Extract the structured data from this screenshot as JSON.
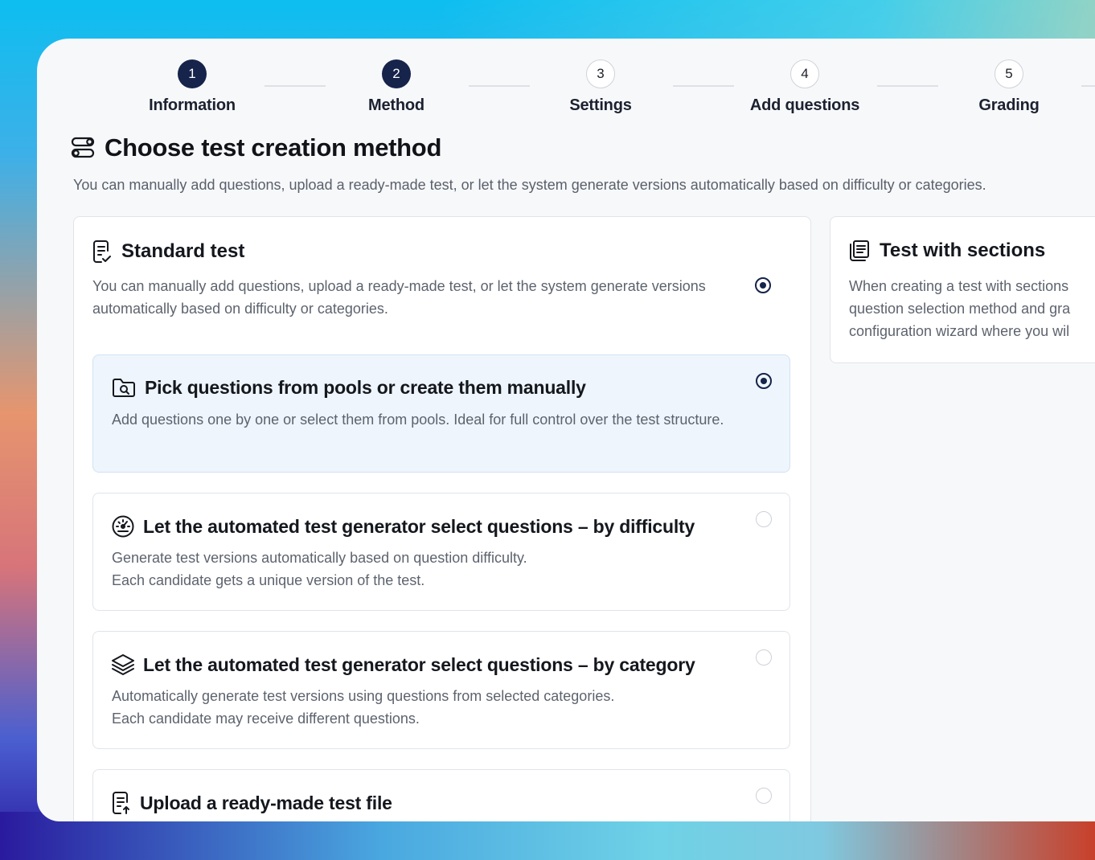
{
  "stepper": [
    {
      "num": "1",
      "label": "Information",
      "state": "done"
    },
    {
      "num": "2",
      "label": "Method",
      "state": "done"
    },
    {
      "num": "3",
      "label": "Settings",
      "state": "todo"
    },
    {
      "num": "4",
      "label": "Add questions",
      "state": "todo"
    },
    {
      "num": "5",
      "label": "Grading",
      "state": "todo"
    }
  ],
  "page": {
    "title": "Choose test creation method",
    "subtitle": "You can manually add questions, upload a ready-made test, or let the system generate versions automatically based on difficulty or categories."
  },
  "standard": {
    "title": "Standard test",
    "description": "You can manually add questions, upload a ready-made test, or let the system generate versions automatically based on difficulty or categories.",
    "selected": true,
    "options": [
      {
        "title": "Pick questions from pools or create them manually",
        "description": "Add questions one by one or select them from pools. Ideal for full control over the test structure.",
        "selected": true,
        "icon": "folder-search-icon"
      },
      {
        "title": "Let the automated test generator select questions – by difficulty",
        "description_line1": "Generate test versions automatically based on question difficulty.",
        "description_line2": "Each candidate gets a unique version of the test.",
        "selected": false,
        "icon": "gauge-icon"
      },
      {
        "title": "Let the automated test generator select questions – by category",
        "description_line1": "Automatically generate test versions using questions from selected categories.",
        "description_line2": "Each candidate may receive different questions.",
        "selected": false,
        "icon": "layers-icon"
      },
      {
        "title": "Upload a ready-made test file",
        "selected": false,
        "icon": "file-upload-icon"
      }
    ]
  },
  "sections": {
    "title": "Test with sections",
    "line1": "When creating a test with sections",
    "line2": "question selection method and gra",
    "line3": "configuration wizard where you wil"
  },
  "colors": {
    "accent": "#16234a",
    "selected_bg": "#eef5fc"
  }
}
